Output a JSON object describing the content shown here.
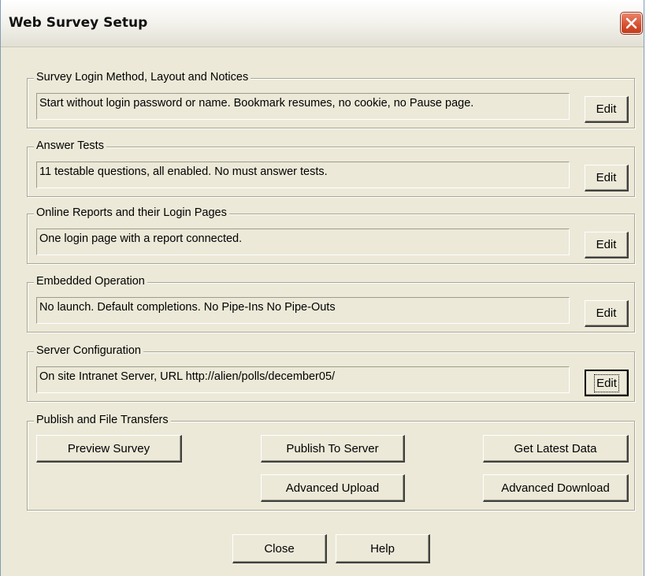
{
  "window": {
    "title": "Web Survey Setup",
    "close_icon": "close-x-icon"
  },
  "sections": [
    {
      "legend": "Survey Login Method, Layout and Notices",
      "summary": "Start without login password or name. Bookmark resumes,  no cookie, no Pause page.",
      "edit_label": "Edit"
    },
    {
      "legend": "Answer Tests",
      "summary": "11 testable questions, all enabled.  No must answer tests.",
      "edit_label": "Edit"
    },
    {
      "legend": "Online Reports and their Login Pages",
      "summary": "One login page with a report connected.",
      "edit_label": "Edit"
    },
    {
      "legend": "Embedded Operation",
      "summary": "No launch. Default completions. No Pipe-Ins No Pipe-Outs",
      "edit_label": "Edit"
    },
    {
      "legend": "Server Configuration",
      "summary": "On site Intranet Server, URL http://alien/polls/december05/",
      "edit_label": "Edit"
    }
  ],
  "publish": {
    "legend": "Publish and File Transfers",
    "preview_label": "Preview Survey",
    "publish_label": "Publish To Server",
    "latest_label": "Get Latest Data",
    "upload_label": "Advanced Upload",
    "download_label": "Advanced Download"
  },
  "footer": {
    "close_label": "Close",
    "help_label": "Help"
  },
  "colors": {
    "dialog_bg": "#ece9d8",
    "close_button": "#d6502f",
    "border": "#a8a695"
  }
}
